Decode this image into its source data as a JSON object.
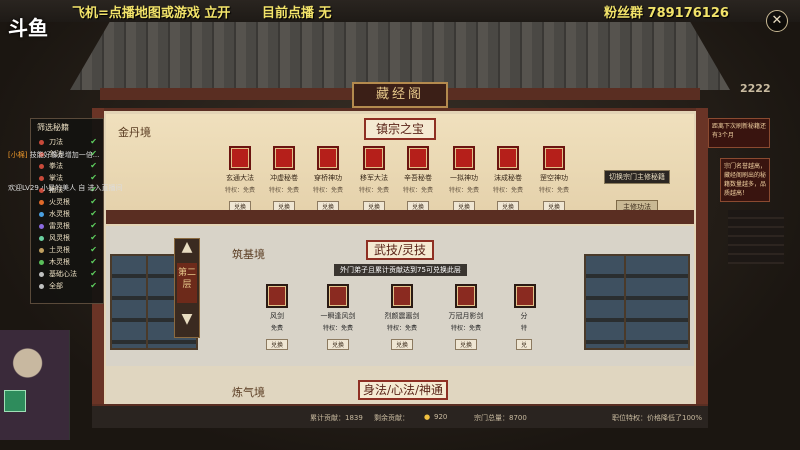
{
  "stream": {
    "logo": "斗鱼",
    "ticker": "飞机=点播地图或游戏 立开",
    "status": "目前点播  无",
    "fans": "粉丝群  789176126",
    "close_label": "✕"
  },
  "building": {
    "plaque": "藏经阁"
  },
  "top_floor": {
    "sign": "金丹境",
    "title": "镇宗之宝",
    "books": [
      {
        "name": "玄通大法",
        "cost": "特权：免费",
        "button": "兑换"
      },
      {
        "name": "冲虚秘卷",
        "cost": "特权：免费",
        "button": "兑换"
      },
      {
        "name": "穿桥神功",
        "cost": "特权：免费",
        "button": "兑换"
      },
      {
        "name": "移军大法",
        "cost": "特权：免费",
        "button": "兑换"
      },
      {
        "name": "辛吾秘卷",
        "cost": "特权：免费",
        "button": "兑换"
      },
      {
        "name": "一拟神功",
        "cost": "特权：免费",
        "button": "兑换"
      },
      {
        "name": "沫成秘卷",
        "cost": "特权：免费",
        "button": "兑换"
      },
      {
        "name": "罡空神功",
        "cost": "特权：免费",
        "button": "兑换"
      }
    ],
    "tooltip": "切换宗门主修秘籍",
    "switch_button": "主修功法"
  },
  "mid_floor": {
    "sign": "筑基境",
    "floor_label": "第二层",
    "title": "武技/灵技",
    "notice": "外门弟子且累计贡献达到75可兑换此层",
    "books": [
      {
        "name": "一瞬逢风剑",
        "cost": "特权：免费",
        "button": "兑换"
      },
      {
        "name": "烈颜震嚣剑",
        "cost": "特权：免费",
        "button": "兑换"
      },
      {
        "name": "万冠月影剑",
        "cost": "特权：免费",
        "button": "兑换"
      }
    ],
    "partial_left": {
      "name": "风剑",
      "cost": "免费",
      "button": "兑换"
    },
    "partial_right": {
      "name": "分",
      "cost": "特",
      "button": "兑"
    }
  },
  "bottom_floor": {
    "sign": "炼气境",
    "title": "身法/心法/神通"
  },
  "footer": {
    "accumulated": "累计贡献：1839",
    "remaining": "剩余贡献：",
    "remaining_value": "920",
    "sect": "宗门总量：8700",
    "perk": "职位特权：价格降低了100%"
  },
  "filter": {
    "title": "筛选秘籍",
    "items": [
      {
        "label": "刀法",
        "color": "#c94a3a"
      },
      {
        "label": "剑法",
        "color": "#c94a3a"
      },
      {
        "label": "拳法",
        "color": "#c94a3a"
      },
      {
        "label": "掌法",
        "color": "#c94a3a"
      },
      {
        "label": "指法",
        "color": "#c94a3a"
      },
      {
        "label": "火灵根",
        "color": "#e06a2a"
      },
      {
        "label": "水灵根",
        "color": "#4aa0e0"
      },
      {
        "label": "雷灵根",
        "color": "#8a6ae0"
      },
      {
        "label": "风灵根",
        "color": "#6ad0a0"
      },
      {
        "label": "土灵根",
        "color": "#c0a060"
      },
      {
        "label": "木灵根",
        "color": "#5ac05a"
      },
      {
        "label": "基础心法",
        "color": "#c0c0c0"
      },
      {
        "label": "全部",
        "color": "#c0c0c0"
      }
    ],
    "check": "✔"
  },
  "chat": [
    {
      "name": "[小棉]",
      "text": "技能好像是增加一倍..."
    },
    {
      "name": "",
      "text": "欢迎LV29 小星的美人 自 进入直播间"
    }
  ],
  "right_side": {
    "notice1": "距离下次刷新秘籍还有3个月",
    "notice2": "宗门名誉越高，藏经阁刷出的秘籍数量越多，品质越高！",
    "count": "2222"
  }
}
